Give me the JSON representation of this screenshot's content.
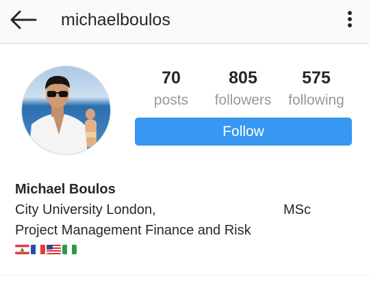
{
  "header": {
    "username": "michaelboulos",
    "back_icon": "arrow-left-icon",
    "more_icon": "vertical-dots-icon"
  },
  "stats": [
    {
      "value": "70",
      "label": "posts"
    },
    {
      "value": "805",
      "label": "followers"
    },
    {
      "value": "575",
      "label": "following"
    }
  ],
  "follow_button": {
    "label": "Follow",
    "color": "#3897f0"
  },
  "bio": {
    "name": "Michael Boulos",
    "line1_left": "City University London,",
    "line1_right": "MSc",
    "line2": "Project Management Finance and Risk",
    "flags": [
      "lebanon-flag",
      "france-flag",
      "usa-flag",
      "nigeria-flag"
    ]
  }
}
